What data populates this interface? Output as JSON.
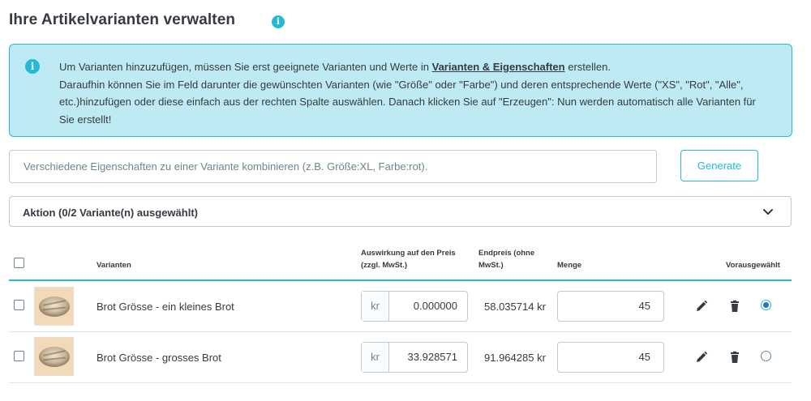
{
  "header": {
    "title": "Ihre Artikelvarianten verwalten",
    "info_icon": "info-icon"
  },
  "alert": {
    "icon": "info-icon",
    "line1_before": "Um Varianten hinzuzufügen, müssen Sie erst geeignete Varianten und Werte in ",
    "link": "Varianten & Eigenschaften",
    "line1_after": " erstellen.",
    "rest": "Daraufhin können Sie im Feld darunter die gewünschten Varianten (wie \"Größe\" oder \"Farbe\") und deren entsprechende Werte (\"XS\", \"Rot\", \"Alle\", etc.)hinzufügen oder diese einfach aus der rechten Spalte auswählen. Danach klicken Sie auf \"Erzeugen\": Nun werden automatisch alle Varianten für Sie erstellt!"
  },
  "combinator": {
    "placeholder": "Verschiedene Eigenschaften zu einer Variante kombinieren (z.B. Größe:XL, Farbe:rot).",
    "value": "",
    "generate_label": "Generate"
  },
  "action_bar": {
    "label": "Aktion (0/2 Variante(n) ausgewählt)",
    "chevron_icon": "chevron-down-icon"
  },
  "table": {
    "headers": {
      "variants": "Varianten",
      "price_impact_1": "Auswirkung auf den Preis",
      "price_impact_2": "(zzgl. MwSt.)",
      "final_price_1": "Endpreis (ohne",
      "final_price_2": "MwSt.)",
      "quantity": "Menge",
      "default": "Vorausgewählt"
    },
    "rows": [
      {
        "name": "Brot Grösse - ein kleines Brot",
        "currency": "kr",
        "price_impact": "0.000000",
        "final_price": "58.035714 kr",
        "quantity": "45",
        "checked": false,
        "default": true
      },
      {
        "name": "Brot Grösse - grosses Brot",
        "currency": "kr",
        "price_impact": "33.928571",
        "final_price": "91.964285 kr",
        "quantity": "45",
        "checked": false,
        "default": false
      }
    ]
  },
  "colors": {
    "accent": "#25b9d7",
    "alert_bg": "#beeaf3",
    "text": "#363a41",
    "radio_selected": "#2471c9"
  }
}
